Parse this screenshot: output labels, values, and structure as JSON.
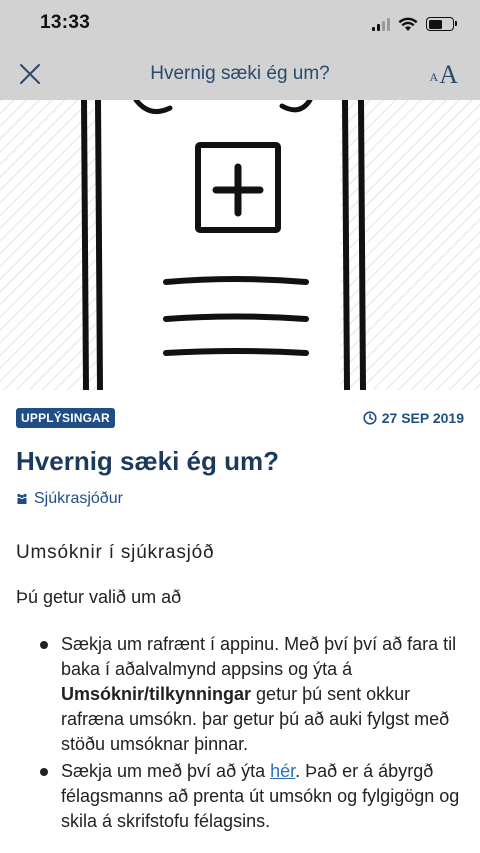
{
  "status_bar": {
    "time": "13:33"
  },
  "nav": {
    "title": "Hvernig sæki ég um?",
    "font_small": "A",
    "font_large": "A"
  },
  "article": {
    "badge": "UPPLÝSINGAR",
    "date": "27 SEP 2019",
    "title": "Hvernig sæki ég um?",
    "category": "Sjúkrasjóður",
    "intro_heading": "Umsóknir í sjúkrasjóð",
    "intro_line": "Þú getur valið um að",
    "bullet1": {
      "part1": "Sækja um rafrænt í appinu. Með því því að fara til baka í aðalvalmynd appsins og ýta á ",
      "bold": "Umsóknir/tilkynningar",
      "part2": " getur þú sent okkur rafræna umsókn. þar getur þú að auki fylgst með stöðu umsóknar þinnar."
    },
    "bullet2": {
      "part1": "Sækja um með því að ýta ",
      "link": "hér",
      "part2": ". Það er á ábyrgð félagsmanns að prenta út umsókn og fylgigögn og skila á skrifstofu félagsins."
    }
  },
  "colors": {
    "bar_bg": "#d2d2d2",
    "accent": "#1f4e87",
    "title": "#1b3a5c"
  },
  "icons": {
    "close": "close-icon",
    "font_size": "font-size-icon",
    "clock": "clock-icon",
    "people": "people-icon"
  }
}
